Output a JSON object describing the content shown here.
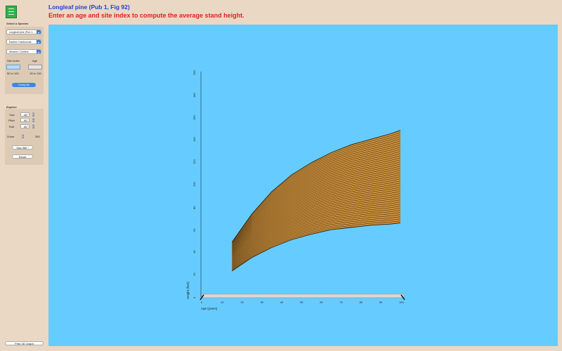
{
  "header": {
    "title": "Longleaf pine (Pub 1, Fig 92)",
    "instruction": "Enter an age and site index to compute the average stand height."
  },
  "species_panel": {
    "title": "Select a Species",
    "dropdowns": [
      "Longleaf pine (Pub 1...",
      "Eastern Hardwoods",
      "Western Conifers"
    ],
    "site_index_label": "Site Index",
    "age_label": "Age",
    "site_index_value": "",
    "age_value": "",
    "site_index_range": "50 to 120",
    "age_range": "15 to 100",
    "compute_label": "Compute"
  },
  "explore_panel": {
    "title": "Explore",
    "yaw_label": "Yaw",
    "yaw_value": "45°",
    "pitch_label": "Pitch",
    "pitch_value": "90°",
    "roll_label": "Roll",
    "roll_value": "90°",
    "zoom_label": "Zoom",
    "zoom_value": "350",
    "yaw360_label": "Yaw 360 °",
    "reset_label": "Reset"
  },
  "print_label": "Print 3D Graph",
  "chart_data": {
    "type": "area",
    "xlabel": "Age (years)",
    "ylabel": "Height (feet)",
    "xlim": [
      0,
      100
    ],
    "ylim": [
      0,
      200
    ],
    "x_ticks": [
      0,
      10,
      20,
      30,
      40,
      50,
      60,
      70,
      80,
      90,
      100
    ],
    "y_ticks": [
      0,
      20,
      40,
      60,
      80,
      100,
      120,
      140,
      160,
      180,
      200
    ],
    "x": [
      15,
      25,
      35,
      45,
      55,
      65,
      75,
      85,
      95,
      100
    ],
    "series": [
      {
        "values": [
          22,
          34,
          43,
          50,
          55,
          59,
          61,
          63,
          64,
          65
        ]
      },
      {
        "values": [
          48,
          73,
          93,
          108,
          119,
          128,
          135,
          140,
          145,
          148
        ]
      }
    ],
    "surface_fill": "#c98f3c",
    "line_color": "#2a1a08",
    "grid": false
  }
}
